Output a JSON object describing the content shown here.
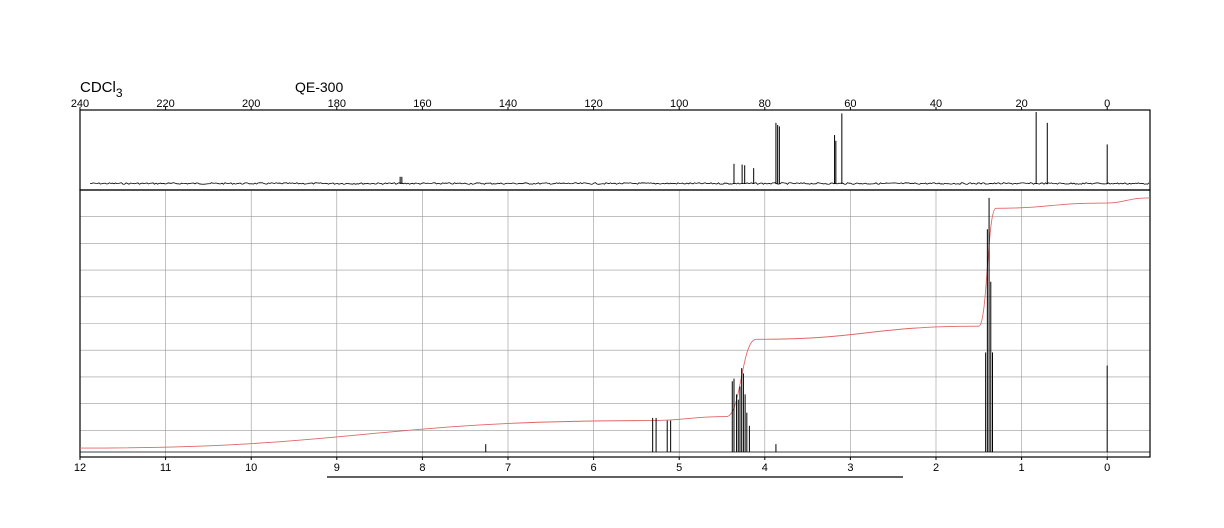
{
  "header": {
    "solvent_main": "CDCl",
    "solvent_sub": "3",
    "instrument": "QE-300"
  },
  "colors": {
    "spectrum": "#000000",
    "integral": "#e06666",
    "grid": "#9a9a9a",
    "frame": "#000000"
  },
  "chart_data": [
    {
      "type": "line",
      "name": "13C NMR spectrum",
      "xlim": [
        240,
        -10
      ],
      "x_ticks": [
        240,
        220,
        200,
        180,
        160,
        140,
        120,
        100,
        80,
        60,
        40,
        20,
        0
      ],
      "x_ticklabels": [
        "240",
        "220",
        "200",
        "180",
        "160",
        "140",
        "120",
        "100",
        "80",
        "60",
        "40",
        "20",
        "0"
      ],
      "grid": false,
      "peaks": [
        {
          "ppm": 165.2,
          "height": 0.1
        },
        {
          "ppm": 164.8,
          "height": 0.1
        },
        {
          "ppm": 87.2,
          "height": 0.28
        },
        {
          "ppm": 85.3,
          "height": 0.27
        },
        {
          "ppm": 84.7,
          "height": 0.26
        },
        {
          "ppm": 82.6,
          "height": 0.22
        },
        {
          "ppm": 77.4,
          "height": 0.85
        },
        {
          "ppm": 77.0,
          "height": 0.82
        },
        {
          "ppm": 76.6,
          "height": 0.8
        },
        {
          "ppm": 63.7,
          "height": 0.68
        },
        {
          "ppm": 63.4,
          "height": 0.6
        },
        {
          "ppm": 62.0,
          "height": 0.98
        },
        {
          "ppm": 16.6,
          "height": 1.0
        },
        {
          "ppm": 14.0,
          "height": 0.85
        },
        {
          "ppm": 0.0,
          "height": 0.55
        }
      ]
    },
    {
      "type": "line",
      "name": "1H NMR spectrum",
      "xlim": [
        12,
        -0.5
      ],
      "x_ticks": [
        12,
        11,
        10,
        9,
        8,
        7,
        6,
        5,
        4,
        3,
        2,
        1,
        0
      ],
      "x_ticklabels": [
        "12",
        "11",
        "10",
        "9",
        "8",
        "7",
        "6",
        "5",
        "4",
        "3",
        "2",
        "1",
        "0"
      ],
      "grid": true,
      "peaks": [
        {
          "ppm": 7.26,
          "height": 0.03
        },
        {
          "ppm": 5.31,
          "height": 0.13
        },
        {
          "ppm": 5.27,
          "height": 0.13
        },
        {
          "ppm": 5.14,
          "height": 0.12
        },
        {
          "ppm": 5.1,
          "height": 0.12
        },
        {
          "ppm": 4.38,
          "height": 0.27
        },
        {
          "ppm": 4.36,
          "height": 0.28
        },
        {
          "ppm": 4.33,
          "height": 0.22
        },
        {
          "ppm": 4.31,
          "height": 0.2
        },
        {
          "ppm": 4.29,
          "height": 0.25
        },
        {
          "ppm": 4.27,
          "height": 0.32
        },
        {
          "ppm": 4.25,
          "height": 0.3
        },
        {
          "ppm": 4.23,
          "height": 0.22
        },
        {
          "ppm": 4.21,
          "height": 0.15
        },
        {
          "ppm": 4.18,
          "height": 0.1
        },
        {
          "ppm": 3.87,
          "height": 0.03
        },
        {
          "ppm": 1.42,
          "height": 0.38
        },
        {
          "ppm": 1.4,
          "height": 0.85
        },
        {
          "ppm": 1.38,
          "height": 0.97
        },
        {
          "ppm": 1.36,
          "height": 0.65
        },
        {
          "ppm": 1.34,
          "height": 0.38
        },
        {
          "ppm": 0.0,
          "height": 0.33
        }
      ],
      "integral_steps": [
        {
          "from": 12.0,
          "to": 5.35,
          "level_from": 0.015,
          "level_to": 0.12
        },
        {
          "from": 5.35,
          "to": 4.45,
          "level_from": 0.12,
          "level_to": 0.135
        },
        {
          "from": 4.45,
          "to": 4.1,
          "level_from": 0.135,
          "level_to": 0.43
        },
        {
          "from": 4.1,
          "to": 1.5,
          "level_from": 0.43,
          "level_to": 0.48
        },
        {
          "from": 1.5,
          "to": 1.3,
          "level_from": 0.48,
          "level_to": 0.93
        },
        {
          "from": 1.3,
          "to": 0.05,
          "level_from": 0.93,
          "level_to": 0.95
        },
        {
          "from": 0.05,
          "to": -0.5,
          "level_from": 0.95,
          "level_to": 0.97
        }
      ]
    }
  ]
}
